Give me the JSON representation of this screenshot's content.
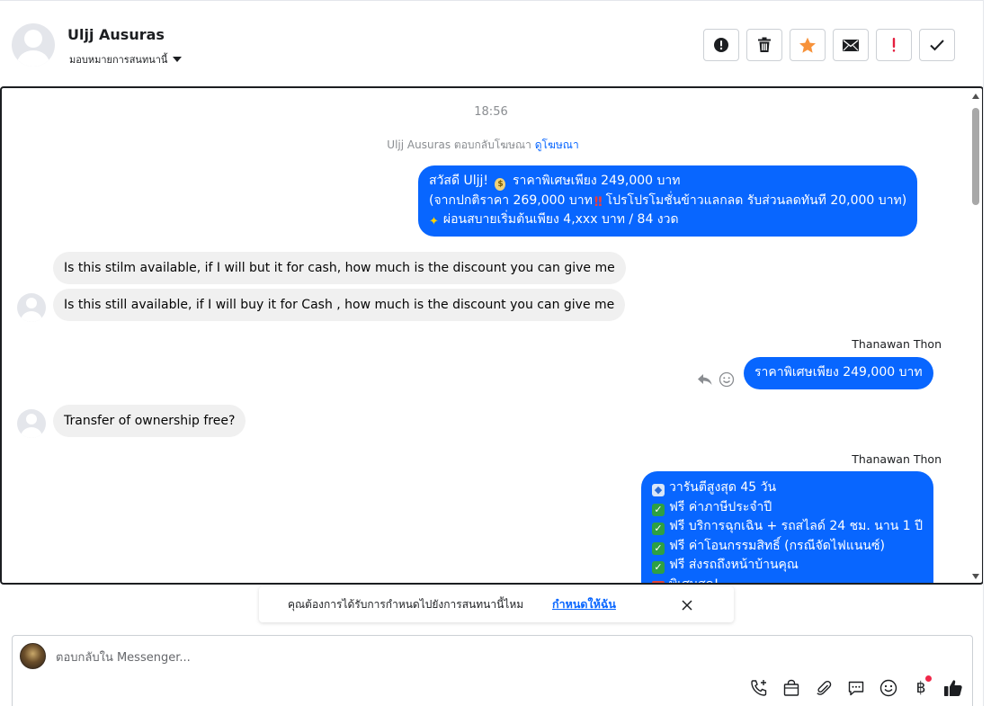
{
  "header": {
    "contact_name": "Uljj Ausuras",
    "assign_label": "มอบหมายการสนทนานี้",
    "actions": [
      {
        "name": "spam-report-button",
        "icon": "alert-circle-icon"
      },
      {
        "name": "delete-button",
        "icon": "trash-icon"
      },
      {
        "name": "star-button",
        "icon": "star-icon"
      },
      {
        "name": "mark-unread-button",
        "icon": "envelope-icon"
      },
      {
        "name": "follow-up-button",
        "icon": "exclamation-icon"
      },
      {
        "name": "mark-done-button",
        "icon": "checkmark-icon"
      }
    ]
  },
  "chat": {
    "timestamp": "18:56",
    "ad_reply_text": "Uljj Ausuras ตอบกลับโฆษณา",
    "ad_link": "ดูโฆษณา",
    "msg1": {
      "line1_a": "สวัสดี Uljj!",
      "line1_b": "ราคาพิเศษเพียง 249,000 บาท",
      "line2_a": "(จากปกติราคา 269,000 บาท",
      "line2_b": "โปรโปรโมชั่นข้าวแลกลด รับส่วนลดทันที 20,000 บาท)",
      "line3": "ผ่อนสบายเริ่มต้นเพียง 4,xxx บาท / 84 งวด"
    },
    "msg2": "Is this stilm available, if I will but it for cash, how much is the discount you can give me",
    "msg3": "Is this still available, if I will buy it for Cash , how much is the discount you can give me",
    "sender1": "Thanawan Thon",
    "msg4": "ราคาพิเศษเพียง 249,000 บาท",
    "msg5": "Transfer of ownership free?",
    "sender2": "Thanawan Thon",
    "msg6": {
      "line1": "วารันตีสูงสุด 45 วัน",
      "line2": "ฟรี ค่าภาษีประจำปี",
      "line3": "ฟรี บริการฉุกเฉิน + รถสไลด์ 24 ชม. นาน 1 ปี",
      "line4": "ฟรี ค่าโอนกรรมสิทธิ์ (กรณีจัดไฟแนนซ์)",
      "line5": "ฟรี ส่งรถถึงหน้าบ้านคุณ",
      "line6": "พิเศษสุด!"
    }
  },
  "notice": {
    "text": "คุณต้องการได้รับการกำหนดไปยังการสนทนานี้ไหม",
    "link": "กำหนดให้ฉัน"
  },
  "composer": {
    "placeholder": "ตอบกลับใน Messenger...",
    "baht_symbol": "฿"
  },
  "colors": {
    "accent": "#0866ff",
    "incoming_bubble": "#f0f0f0",
    "star": "#f7923a",
    "follow_up": "#e41e3f"
  }
}
